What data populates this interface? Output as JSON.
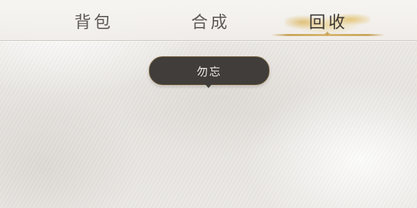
{
  "tabs": [
    {
      "label": "背包",
      "active": false
    },
    {
      "label": "合成",
      "active": false
    },
    {
      "label": "回收",
      "active": true
    }
  ],
  "tooltip": {
    "text": "勿忘"
  },
  "colors": {
    "active_accent": "#c9a45a",
    "tab_text": "#5f5b56",
    "tooltip_bg": "#403d3a",
    "tooltip_text": "#f1eee8"
  },
  "icons": [
    "diamond-ornament-icon",
    "tooltip-arrow-icon"
  ]
}
